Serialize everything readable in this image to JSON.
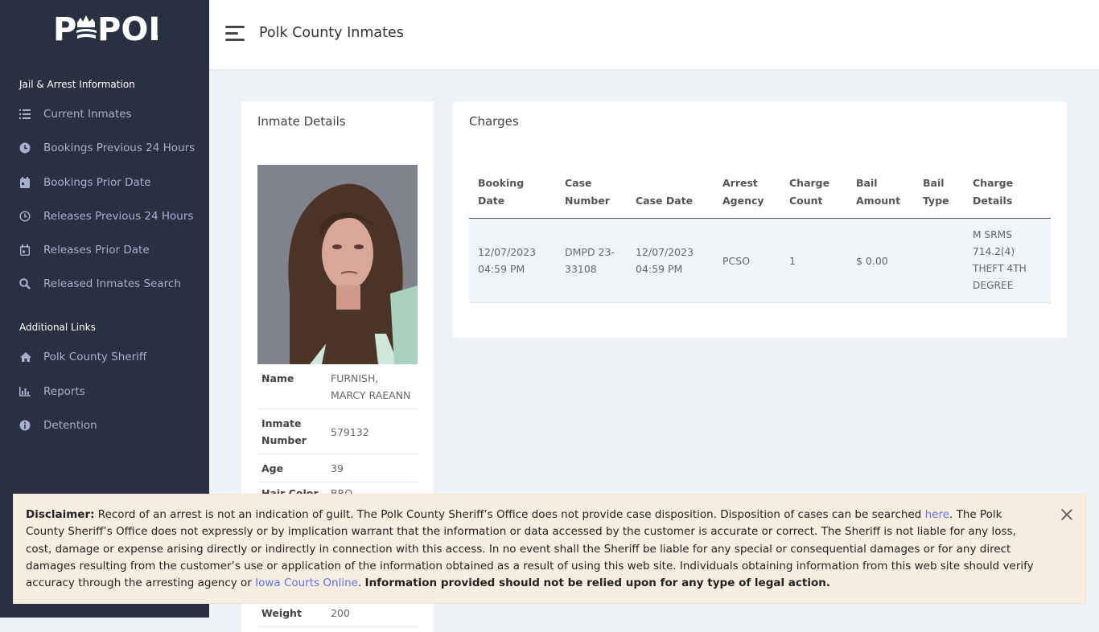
{
  "brand": {
    "logo_text": "POLK"
  },
  "sidebar": {
    "section1_title": "Jail & Arrest Information",
    "items": [
      {
        "label": "Current Inmates",
        "icon": "list-icon"
      },
      {
        "label": "Bookings Previous 24 Hours",
        "icon": "clock-icon"
      },
      {
        "label": "Bookings Prior Date",
        "icon": "calendar-icon"
      },
      {
        "label": "Releases Previous 24 Hours",
        "icon": "clock-outline-icon"
      },
      {
        "label": "Releases Prior Date",
        "icon": "calendar-outline-icon"
      },
      {
        "label": "Released Inmates Search",
        "icon": "search-icon"
      }
    ],
    "section2_title": "Additional Links",
    "links": [
      {
        "label": "Polk County Sheriff",
        "icon": "home-icon"
      },
      {
        "label": "Reports",
        "icon": "bar-chart-icon"
      },
      {
        "label": "Detention",
        "icon": "info-icon"
      }
    ]
  },
  "header": {
    "title": "Polk County Inmates"
  },
  "inmate": {
    "card_title": "Inmate Details",
    "fields": [
      {
        "label": "Name",
        "value": "FURNISH, MARCY RAEANN"
      },
      {
        "label": "Inmate Number",
        "value": "579132"
      },
      {
        "label": "Age",
        "value": "39"
      },
      {
        "label": "Hair Color",
        "value": "BRO"
      },
      {
        "label": "Weight",
        "value": "200"
      }
    ]
  },
  "charges": {
    "card_title": "Charges",
    "columns": [
      "Booking Date",
      "Case Number",
      "Case Date",
      "Arrest Agency",
      "Charge Count",
      "Bail Amount",
      "Bail Type",
      "Charge Details"
    ],
    "rows": [
      [
        "12/07/2023 04:59 PM",
        "DMPD 23-33108",
        "12/07/2023 04:59 PM",
        "PCSO",
        "1",
        "$ 0.00",
        "",
        "M SRMS 714.2(4) THEFT 4TH DEGREE"
      ]
    ]
  },
  "disclaimer": {
    "label": "Disclaimer:",
    "text1": " Record of an arrest is not an indication of guilt. The Polk County Sheriff’s Office does not provide case disposition. Disposition of cases can be searched ",
    "link1": "here",
    "text2": ". The Polk County Sheriff’s Office does not expressly or by implication warrant that the information or data accessed by the customer is accurate or correct. The Sheriff is not liable for any loss, cost, damage or expense arising directly or indirectly in connection with this access. In no event shall the Sheriff be liable for any special or consequential damages or for any direct damages resulting from the customer’s use or application of the information obtained as a result of using this web site. Individuals obtaining information from this web site should verify accuracy through the arresting agency or ",
    "link2": "Iowa Courts Online",
    "text3": ". ",
    "bold_tail": "Information provided should not be relied upon for any type of legal action."
  },
  "colors": {
    "sidebar_bg": "#2a3042",
    "sidebar_text": "#a6b0cf",
    "link": "#5b73e8",
    "disclaimer_bg": "#f8eedf"
  }
}
